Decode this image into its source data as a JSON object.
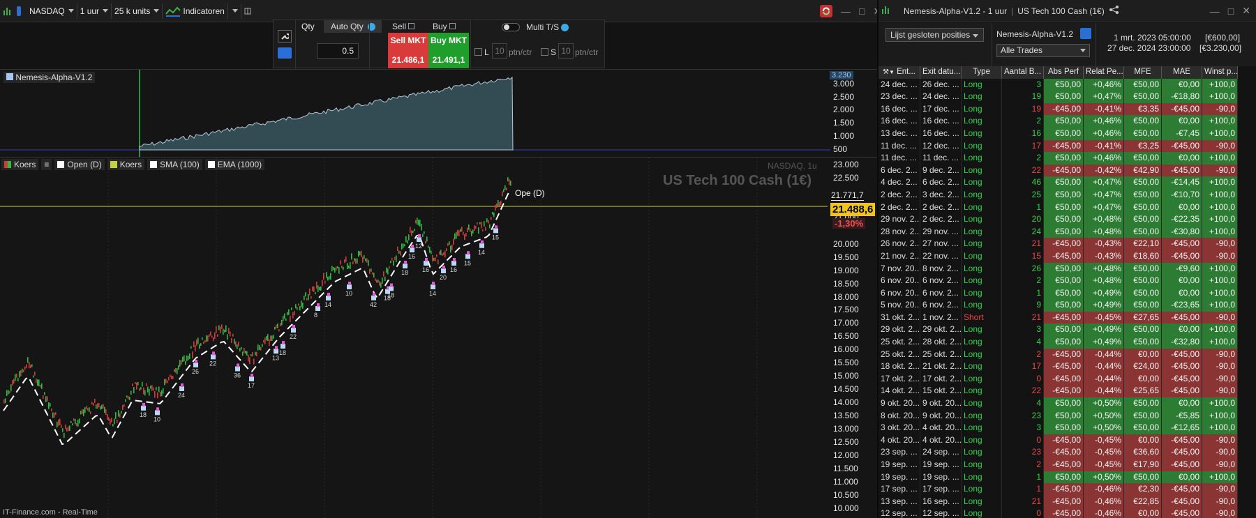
{
  "left_toolbar": {
    "instrument": "NASDAQ",
    "timeframe": "1 uur",
    "units": "25 k units",
    "indicators": "Indicatoren"
  },
  "order_panel": {
    "qty_label": "Qty",
    "auto_qty_label": "Auto Qty",
    "qty_value": "0.5",
    "sell_label": "Sell",
    "buy_label": "Buy",
    "sell_mkt_label": "Sell MKT",
    "buy_mkt_label": "Buy MKT",
    "sell_price": "21.486,1",
    "buy_price": "21.491,1",
    "multi_label": "Multi T/S",
    "l_label": "L",
    "s_label": "S",
    "l_value": "10",
    "s_value": "10",
    "l_unit": "ptn/ctr",
    "s_unit": "ptn/ctr"
  },
  "equity_panel": {
    "name": "Nemesis-Alpha-V1.2",
    "y_ticks": [
      "3.230",
      "3.000",
      "2.500",
      "2.000",
      "1.500",
      "1.000",
      "500"
    ]
  },
  "price_panel": {
    "legend": [
      "Koers",
      "Open (D)",
      "Koers",
      "SMA (100)",
      "EMA (1000)"
    ],
    "source_label": "NASDAQ, 1u",
    "instrument_title": "US Tech 100 Cash (1€)",
    "high_label": "21.771,7",
    "current_price": "21.488,6",
    "change_pct": "-1,30%",
    "open_label": "Ope (D)",
    "y_ticks": [
      "23.000",
      "22.500",
      "22.000",
      "21.500",
      "21.000",
      "20.500",
      "20.000",
      "19.500",
      "19.000",
      "18.500",
      "18.000",
      "17.500",
      "17.000",
      "16.500",
      "16.000",
      "15.500",
      "15.000",
      "14.500",
      "14.000",
      "13.500",
      "13.000",
      "12.500",
      "12.000",
      "11.500",
      "11.000",
      "10.500",
      "10.000"
    ],
    "footer": "IT-Finance.com - Real-Time",
    "trade_counts": [
      "18",
      "10",
      "24",
      "26",
      "22",
      "36",
      "17",
      "13",
      "18",
      "22",
      "14",
      "10",
      "42",
      "18",
      "18",
      "16",
      "16",
      "14",
      "20",
      "16",
      "15",
      "14",
      "15",
      "18",
      "12",
      "8"
    ]
  },
  "right_panel": {
    "title": "Nemesis-Alpha-V1.2 - 1 uur",
    "instrument": "US Tech 100 Cash (1€)",
    "view_select": "Lijst gesloten posities",
    "system_name": "Nemesis-Alpha-V1.2",
    "trades_filter": "Alle Trades",
    "date_start": "1 mrt. 2023 05:00:00",
    "date_end": "27 dec. 2024 23:00:00",
    "value_start": "[€600,00]",
    "value_end": "[€3.230,00]"
  },
  "table": {
    "headers": [
      "Ent...",
      "Exit datu...",
      "Type",
      "Aantal B...",
      "Abs Perf",
      "Relat Pe...",
      "MFE",
      "MAE",
      "Winst p..."
    ],
    "rows": [
      [
        "24 dec. ...",
        "26 dec. ...",
        "Long",
        "3",
        "€50,00",
        "+0,46%",
        "€50,00",
        "€0,00",
        "+100,0"
      ],
      [
        "23 dec. ...",
        "24 dec. ...",
        "Long",
        "19",
        "€50,00",
        "+0,47%",
        "€50,00",
        "-€18,80",
        "+100,0"
      ],
      [
        "16 dec. ...",
        "17 dec. ...",
        "Long",
        "19",
        "-€45,00",
        "-0,41%",
        "€3,35",
        "-€45,00",
        "-90,0"
      ],
      [
        "16 dec. ...",
        "16 dec. ...",
        "Long",
        "2",
        "€50,00",
        "+0,46%",
        "€50,00",
        "€0,00",
        "+100,0"
      ],
      [
        "13 dec. ...",
        "16 dec. ...",
        "Long",
        "16",
        "€50,00",
        "+0,46%",
        "€50,00",
        "-€7,45",
        "+100,0"
      ],
      [
        "11 dec. ...",
        "12 dec. ...",
        "Long",
        "17",
        "-€45,00",
        "-0,41%",
        "€3,25",
        "-€45,00",
        "-90,0"
      ],
      [
        "11 dec. ...",
        "11 dec. ...",
        "Long",
        "2",
        "€50,00",
        "+0,46%",
        "€50,00",
        "€0,00",
        "+100,0"
      ],
      [
        "6 dec. 2...",
        "9 dec. 2...",
        "Long",
        "22",
        "-€45,00",
        "-0,42%",
        "€42,90",
        "-€45,00",
        "-90,0"
      ],
      [
        "4 dec. 2...",
        "6 dec. 2...",
        "Long",
        "46",
        "€50,00",
        "+0,47%",
        "€50,00",
        "-€14,45",
        "+100,0"
      ],
      [
        "2 dec. 2...",
        "3 dec. 2...",
        "Long",
        "25",
        "€50,00",
        "+0,47%",
        "€50,00",
        "-€10,70",
        "+100,0"
      ],
      [
        "2 dec. 2...",
        "2 dec. 2...",
        "Long",
        "1",
        "€50,00",
        "+0,47%",
        "€50,00",
        "€0,00",
        "+100,0"
      ],
      [
        "29 nov. 2...",
        "2 dec. 2...",
        "Long",
        "20",
        "€50,00",
        "+0,48%",
        "€50,00",
        "-€22,35",
        "+100,0"
      ],
      [
        "28 nov. 2...",
        "29 nov. ...",
        "Long",
        "24",
        "€50,00",
        "+0,48%",
        "€50,00",
        "-€30,80",
        "+100,0"
      ],
      [
        "26 nov. 2...",
        "27 nov. ...",
        "Long",
        "21",
        "-€45,00",
        "-0,43%",
        "€22,10",
        "-€45,00",
        "-90,0"
      ],
      [
        "21 nov. 2...",
        "22 nov. ...",
        "Long",
        "15",
        "-€45,00",
        "-0,43%",
        "€18,60",
        "-€45,00",
        "-90,0"
      ],
      [
        "7 nov. 20...",
        "8 nov. 2...",
        "Long",
        "26",
        "€50,00",
        "+0,48%",
        "€50,00",
        "-€9,60",
        "+100,0"
      ],
      [
        "6 nov. 20...",
        "6 nov. 2...",
        "Long",
        "2",
        "€50,00",
        "+0,48%",
        "€50,00",
        "€0,00",
        "+100,0"
      ],
      [
        "6 nov. 20...",
        "6 nov. 2...",
        "Long",
        "1",
        "€50,00",
        "+0,49%",
        "€50,00",
        "€0,00",
        "+100,0"
      ],
      [
        "5 nov. 20...",
        "6 nov. 2...",
        "Long",
        "9",
        "€50,00",
        "+0,49%",
        "€50,00",
        "-€23,65",
        "+100,0"
      ],
      [
        "31 okt. 2...",
        "1 nov. 2...",
        "Short",
        "21",
        "-€45,00",
        "-0,45%",
        "€27,65",
        "-€45,00",
        "-90,0"
      ],
      [
        "29 okt. 2...",
        "29 okt. 2...",
        "Long",
        "3",
        "€50,00",
        "+0,49%",
        "€50,00",
        "€0,00",
        "+100,0"
      ],
      [
        "25 okt. 2...",
        "28 okt. 2...",
        "Long",
        "4",
        "€50,00",
        "+0,49%",
        "€50,00",
        "-€32,80",
        "+100,0"
      ],
      [
        "25 okt. 2...",
        "25 okt. 2...",
        "Long",
        "2",
        "-€45,00",
        "-0,44%",
        "€0,00",
        "-€45,00",
        "-90,0"
      ],
      [
        "18 okt. 2...",
        "21 okt. 2...",
        "Long",
        "17",
        "-€45,00",
        "-0,44%",
        "€24,00",
        "-€45,00",
        "-90,0"
      ],
      [
        "17 okt. 2...",
        "17 okt. 2...",
        "Long",
        "0",
        "-€45,00",
        "-0,44%",
        "€0,00",
        "-€45,00",
        "-90,0"
      ],
      [
        "14 okt. 2...",
        "15 okt. 2...",
        "Long",
        "22",
        "-€45,00",
        "-0,44%",
        "€25,65",
        "-€45,00",
        "-90,0"
      ],
      [
        "9 okt. 20...",
        "9 okt. 20...",
        "Long",
        "4",
        "€50,00",
        "+0,50%",
        "€50,00",
        "€0,00",
        "+100,0"
      ],
      [
        "8 okt. 20...",
        "9 okt. 20...",
        "Long",
        "23",
        "€50,00",
        "+0,50%",
        "€50,00",
        "-€5,85",
        "+100,0"
      ],
      [
        "3 okt. 20...",
        "4 okt. 20...",
        "Long",
        "3",
        "€50,00",
        "+0,50%",
        "€50,00",
        "-€12,65",
        "+100,0"
      ],
      [
        "4 okt. 20...",
        "4 okt. 20...",
        "Long",
        "0",
        "-€45,00",
        "-0,45%",
        "€0,00",
        "-€45,00",
        "-90,0"
      ],
      [
        "23 sep. ...",
        "24 sep. ...",
        "Long",
        "23",
        "-€45,00",
        "-0,45%",
        "€36,60",
        "-€45,00",
        "-90,0"
      ],
      [
        "19 sep. ...",
        "19 sep. ...",
        "Long",
        "2",
        "-€45,00",
        "-0,45%",
        "€17,90",
        "-€45,00",
        "-90,0"
      ],
      [
        "19 sep. ...",
        "19 sep. ...",
        "Long",
        "1",
        "€50,00",
        "+0,50%",
        "€50,00",
        "€0,00",
        "+100,0"
      ],
      [
        "17 sep. ...",
        "17 sep. ...",
        "Long",
        "1",
        "-€45,00",
        "-0,46%",
        "€2,30",
        "-€45,00",
        "-90,0"
      ],
      [
        "13 sep. ...",
        "16 sep. ...",
        "Long",
        "21",
        "-€45,00",
        "-0,46%",
        "€22,85",
        "-€45,00",
        "-90,0"
      ],
      [
        "12 sep. ...",
        "12 sep. ...",
        "Long",
        "0",
        "-€45,00",
        "-0,46%",
        "€0,00",
        "-€45,00",
        "-90,0"
      ]
    ]
  },
  "colors": {
    "sell": "#d93b3b",
    "buy": "#1f9e2c",
    "price_line": "#c5d23a",
    "equity_fill": "#3b5a63"
  }
}
